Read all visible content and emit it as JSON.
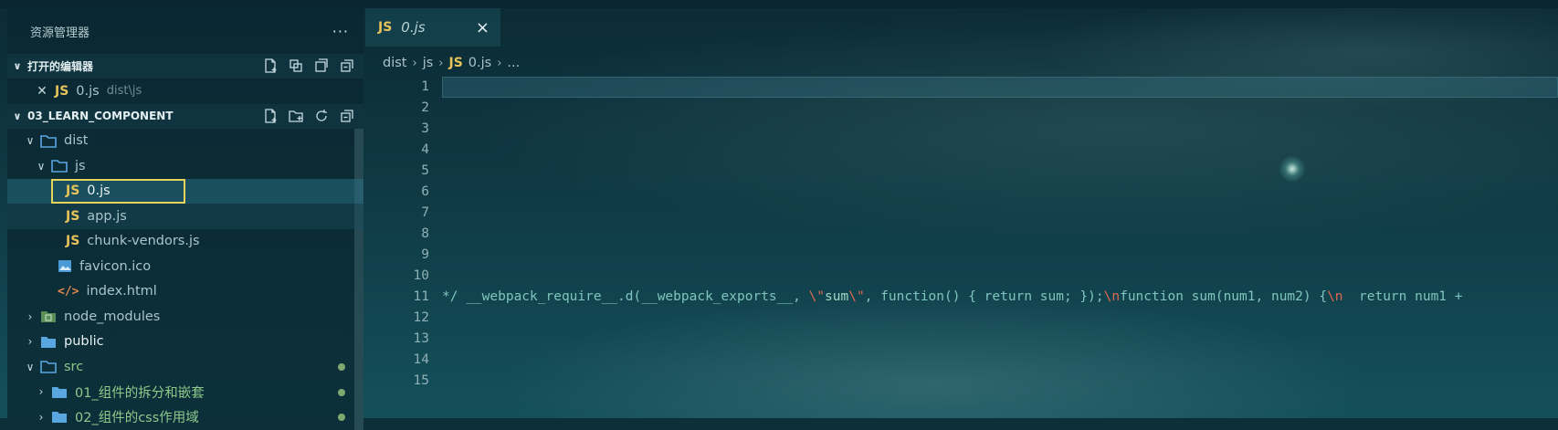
{
  "sidebar": {
    "title": "资源管理器",
    "more": "···",
    "open_editors": {
      "title": "打开的编辑器",
      "items": [
        {
          "icon": "JS",
          "name": "0.js",
          "desc": "dist\\js"
        }
      ]
    },
    "project": {
      "title": "03_LEARN_COMPONENT",
      "tree": [
        {
          "label": "dist",
          "type": "folder-open"
        },
        {
          "label": "js",
          "type": "folder-open"
        },
        {
          "label": "0.js",
          "type": "js",
          "icon": "JS"
        },
        {
          "label": "app.js",
          "type": "js",
          "icon": "JS"
        },
        {
          "label": "chunk-vendors.js",
          "type": "js",
          "icon": "JS"
        },
        {
          "label": "favicon.ico",
          "type": "image"
        },
        {
          "label": "index.html",
          "type": "html"
        },
        {
          "label": "node_modules",
          "type": "folder"
        },
        {
          "label": "public",
          "type": "folder"
        },
        {
          "label": "src",
          "type": "folder-open"
        },
        {
          "label": "01_组件的拆分和嵌套",
          "type": "folder"
        },
        {
          "label": "02_组件的css作用域",
          "type": "folder"
        }
      ]
    }
  },
  "editor": {
    "tab": {
      "icon": "JS",
      "name": "0.js",
      "close": "×"
    },
    "breadcrumb": [
      "dist",
      "js",
      "JS",
      "0.js",
      "..."
    ],
    "line_numbers": [
      "1",
      "2",
      "3",
      "4",
      "5",
      "6",
      "7",
      "8",
      "9",
      "10",
      "11",
      "12",
      "13",
      "14",
      "15"
    ],
    "code_line_11": {
      "p1": "*/ __webpack_require__.d(__webpack_exports__, ",
      "p2": "\\\"",
      "p3": "sum",
      "p4": "\\\"",
      "p5": ", function() { return sum; });",
      "p6": "\\n",
      "p7": "function sum(num1, num2) {",
      "p8": "\\n",
      "p9": "  return num1 +"
    }
  },
  "colors": {
    "accent_js": "#e8c35a",
    "focus_border": "#e6d35a",
    "git_untracked_dot": "#7fa86f"
  }
}
